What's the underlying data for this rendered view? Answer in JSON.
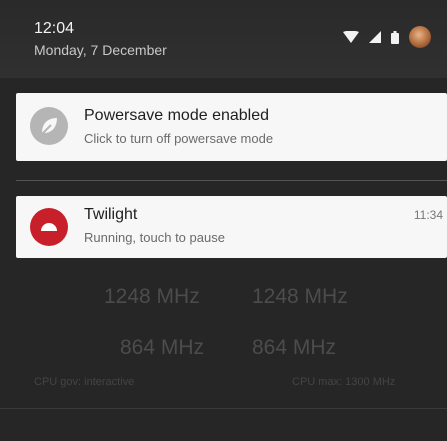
{
  "status_bar": {
    "time": "12:04",
    "date": "Monday, 7 December"
  },
  "notifications": [
    {
      "title": "Powersave mode enabled",
      "text": "Click to turn off powersave mode",
      "icon": "leaf-icon"
    },
    {
      "title": "Twilight",
      "text": "Running, touch to pause",
      "time": "11:34",
      "icon": "twilight-icon",
      "accent": "#c8202a"
    }
  ],
  "widget": {
    "freq_row1": [
      "1248 MHz",
      "1248 MHz"
    ],
    "freq_row2": [
      "864 MHz",
      "864 MHz"
    ],
    "cpu_gov": "CPU gov: interactive",
    "cpu_max": "CPU max: 1300 MHz"
  }
}
